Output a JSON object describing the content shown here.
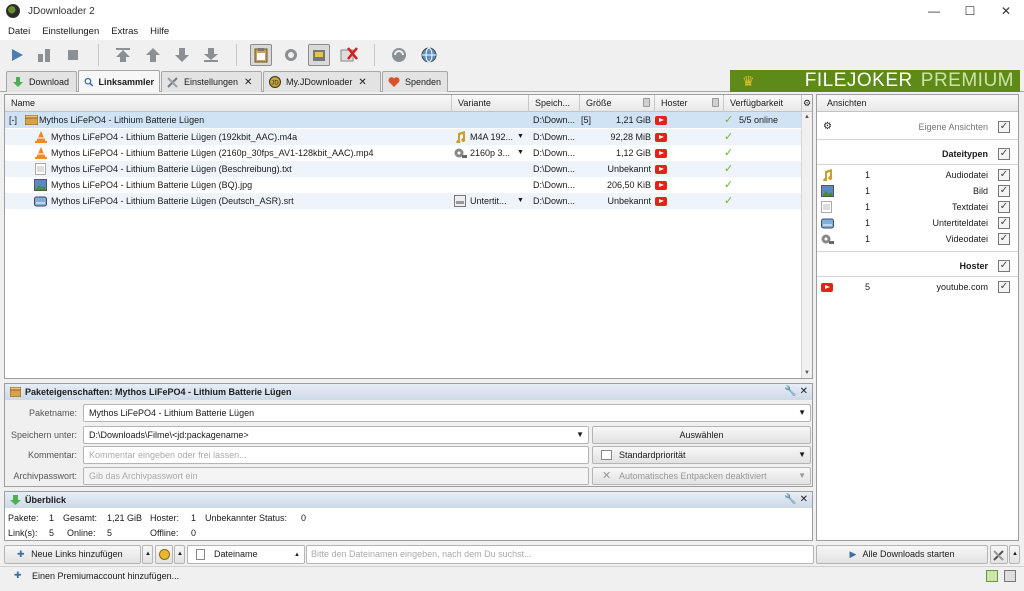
{
  "window": {
    "title": "JDownloader 2",
    "minimize": "—",
    "maximize": "☐",
    "close": "✕"
  },
  "menu": [
    "Datei",
    "Einstellungen",
    "Extras",
    "Hilfe"
  ],
  "tabs": [
    {
      "label": "Download",
      "active": false
    },
    {
      "label": "Linksammler",
      "active": true
    },
    {
      "label": "Einstellungen",
      "active": false
    },
    {
      "label": "My.JDownloader",
      "active": false
    },
    {
      "label": "Spenden",
      "active": false
    }
  ],
  "banner": {
    "left": "FILEJOKER",
    "right": "PREMIUM"
  },
  "table": {
    "columns": [
      "Name",
      "Variante",
      "Speich...",
      "Größe",
      "Hoster",
      "Verfügbarkeit"
    ],
    "package": {
      "toggle": "[-]",
      "name": "Mythos LiFePO4 - Lithium Batterie Lügen",
      "save": "D:\\Down...",
      "count": "[5]",
      "size": "1,21 GiB",
      "availability": "5/5 online"
    },
    "rows": [
      {
        "name": "Mythos LiFePO4 - Lithium Batterie Lügen (192kbit_AAC).m4a",
        "variant": "M4A 192...",
        "save": "D:\\Down...",
        "size": "92,28 MiB",
        "icon": "vlc-icon",
        "variant_icon": "music-icon"
      },
      {
        "name": "Mythos LiFePO4 - Lithium Batterie Lügen (2160p_30fps_AV1-128kbit_AAC).mp4",
        "variant": "2160p 3...",
        "save": "D:\\Down...",
        "size": "1,12 GiB",
        "icon": "vlc-icon",
        "variant_icon": "film-reel-icon"
      },
      {
        "name": "Mythos LiFePO4 - Lithium Batterie Lügen (Beschreibung).txt",
        "variant": "",
        "save": "D:\\Down...",
        "size": "Unbekannt",
        "icon": "text-file-icon"
      },
      {
        "name": "Mythos LiFePO4 - Lithium Batterie Lügen (BQ).jpg",
        "variant": "",
        "save": "D:\\Down...",
        "size": "206,50 KiB",
        "icon": "image-file-icon"
      },
      {
        "name": "Mythos LiFePO4 - Lithium Batterie Lügen (Deutsch_ASR).srt",
        "variant": "Untertit...",
        "save": "D:\\Down...",
        "size": "Unbekannt",
        "icon": "subtitle-file-icon",
        "variant_icon": "subtitle-icon"
      }
    ]
  },
  "right_panel": {
    "header": "Ansichten",
    "own_views": "Eigene Ansichten",
    "filetypes_title": "Dateitypen",
    "filetypes": [
      {
        "count": "1",
        "label": "Audiodatei"
      },
      {
        "count": "1",
        "label": "Bild"
      },
      {
        "count": "1",
        "label": "Textdatei"
      },
      {
        "count": "1",
        "label": "Untertiteldatei"
      },
      {
        "count": "1",
        "label": "Videodatei"
      }
    ],
    "hoster_title": "Hoster",
    "hosters": [
      {
        "count": "5",
        "label": "youtube.com"
      }
    ]
  },
  "props": {
    "title": "Paketeigenschaften: Mythos LiFePO4 - Lithium Batterie Lügen",
    "name_label": "Paketname:",
    "name_value": "Mythos LiFePO4 - Lithium Batterie Lügen",
    "save_label": "Speichern unter:",
    "save_value": "D:\\Downloads\\Filme\\<jd:packagename>",
    "choose_button": "Auswählen",
    "comment_label": "Kommentar:",
    "comment_placeholder": "Kommentar eingeben oder frei lassen...",
    "priority": "Standardpriorität",
    "archive_label": "Archivpasswort:",
    "archive_placeholder": "Gib das Archivpasswort ein",
    "extract": "Automatisches Entpacken deaktiviert"
  },
  "overview": {
    "title": "Überblick",
    "packages_label": "Pakete:",
    "packages": "1",
    "total_label": "Gesamt:",
    "total": "1,21 GiB",
    "hoster_label": "Hoster:",
    "hoster": "1",
    "unknown_label": "Unbekannter Status:",
    "unknown": "0",
    "links_label": "Link(s):",
    "links": "5",
    "online_label": "Online:",
    "online": "5",
    "offline_label": "Offline:",
    "offline": "0"
  },
  "bottom": {
    "add_links": "Neue Links hinzufügen",
    "sort_field": "Dateiname",
    "search_placeholder": "Bitte den Dateinamen eingeben, nach dem Du suchst...",
    "start_all": "Alle Downloads starten"
  },
  "status": {
    "add_premium": "Einen Premiumaccount hinzufügen..."
  },
  "colors": {
    "youtube": "#e62117",
    "selection": "#cfe3f5",
    "banner": "#5e8a17"
  }
}
